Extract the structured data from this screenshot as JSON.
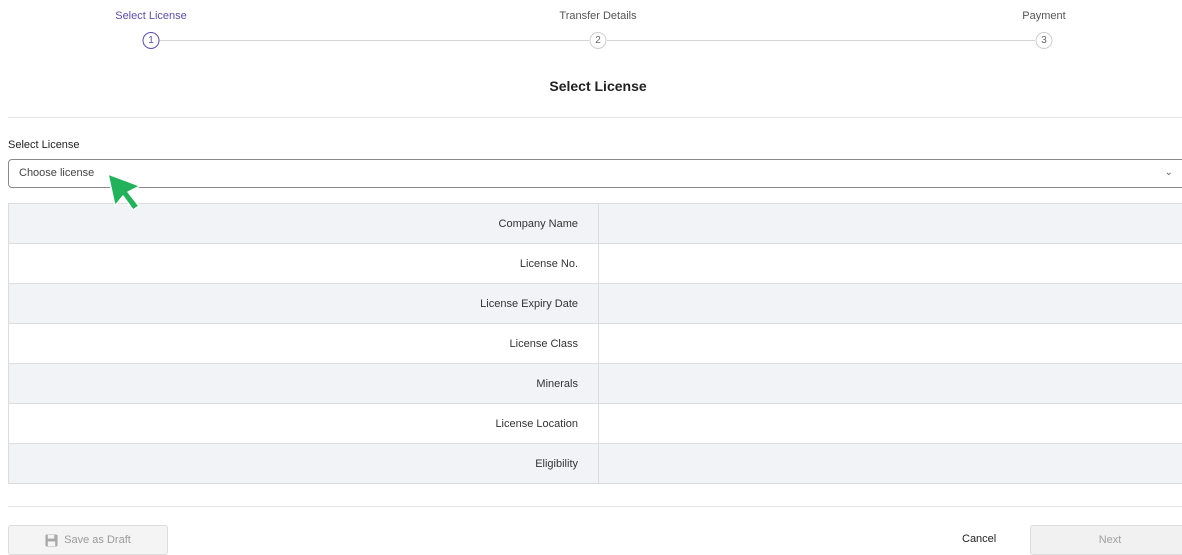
{
  "stepper": {
    "steps": [
      {
        "label": "Select License",
        "number": "1",
        "active": true
      },
      {
        "label": "Transfer Details",
        "number": "2",
        "active": false
      },
      {
        "label": "Payment",
        "number": "3",
        "active": false
      }
    ]
  },
  "page": {
    "title": "Select License"
  },
  "form": {
    "select_label": "Select License",
    "select_placeholder": "Choose license",
    "chevron": "⌄"
  },
  "details": {
    "rows": [
      {
        "label": "Company Name",
        "value": ""
      },
      {
        "label": "License No.",
        "value": ""
      },
      {
        "label": "License Expiry Date",
        "value": ""
      },
      {
        "label": "License Class",
        "value": ""
      },
      {
        "label": "Minerals",
        "value": ""
      },
      {
        "label": "License Location",
        "value": ""
      },
      {
        "label": "Eligibility",
        "value": ""
      }
    ]
  },
  "footer": {
    "save_draft_label": "Save as Draft",
    "save_icon": "save-icon",
    "cancel_label": "Cancel",
    "next_label": "Next"
  },
  "colors": {
    "accent": "#5b4fb0",
    "cursor": "#22b35a"
  }
}
